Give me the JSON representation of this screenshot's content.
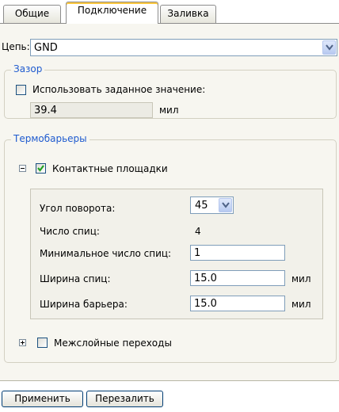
{
  "tabs": [
    {
      "label": "Общие"
    },
    {
      "label": "Подключение"
    },
    {
      "label": "Заливка"
    }
  ],
  "active_tab": "Подключение",
  "net": {
    "label": "Цепь:",
    "value": "GND"
  },
  "clearance": {
    "legend": "Зазор",
    "use_value_label": "Использовать заданное значение:",
    "use_value_checked": false,
    "value": "39.4",
    "unit": "мил"
  },
  "thermals": {
    "legend": "Термобарьеры",
    "pads": {
      "label": "Контактные площадки",
      "checked": true,
      "expanded": true,
      "rotation_label": "Угол поворота:",
      "rotation_value": "45",
      "spokes_label": "Число спиц:",
      "spokes_value": "4",
      "min_spokes_label": "Минимальное число спиц:",
      "min_spokes_value": "1",
      "spoke_width_label": "Ширина спиц:",
      "spoke_width_value": "15.0",
      "spoke_width_unit": "мил",
      "barrier_width_label": "Ширина барьера:",
      "barrier_width_value": "15.0",
      "barrier_width_unit": "мил"
    },
    "vias": {
      "label": "Межслойные переходы",
      "checked": false,
      "expanded": false
    }
  },
  "buttons": {
    "apply": "Применить",
    "repour": "Перезалить"
  }
}
